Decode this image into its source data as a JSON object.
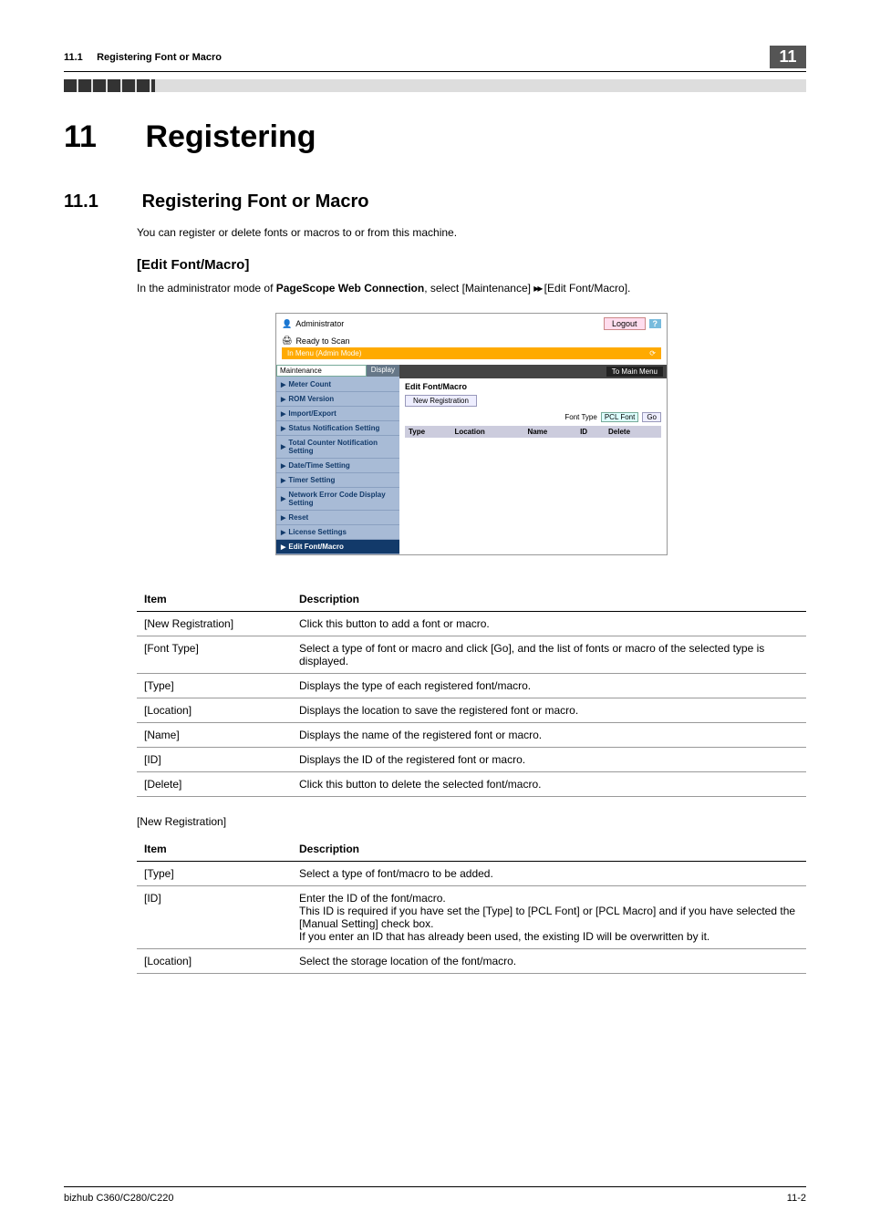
{
  "header": {
    "section_number": "11.1",
    "section_title": "Registering Font or Macro",
    "page_badge": "11"
  },
  "chapter": {
    "number": "11",
    "title": "Registering"
  },
  "section": {
    "number": "11.1",
    "title": "Registering Font or Macro",
    "intro": "You can register or delete fonts or macros to or from this machine."
  },
  "subsection": {
    "title": "[Edit Font/Macro]",
    "instruction_prefix": "In the administrator mode of ",
    "instruction_bold": "PageScope Web Connection",
    "instruction_suffix": ", select [Maintenance] ",
    "instruction_arrows": "▸▸",
    "instruction_tail": " [Edit Font/Macro]."
  },
  "screenshot": {
    "top_user": "Administrator",
    "logout": "Logout",
    "help": "?",
    "status": "Ready to Scan",
    "mode_label": "In Menu (Admin Mode)",
    "sidebar_dropdown": "Maintenance",
    "display_btn": "Display",
    "nav_items": [
      "Meter Count",
      "ROM Version",
      "Import/Export",
      "Status Notification Setting",
      "Total Counter Notification Setting",
      "Date/Time Setting",
      "Timer Setting",
      "Network Error Code Display Setting",
      "Reset",
      "License Settings",
      "Edit Font/Macro"
    ],
    "to_main": "To Main Menu",
    "content_heading": "Edit Font/Macro",
    "new_reg_btn": "New Registration",
    "font_type_label": "Font Type",
    "font_type_value": "PCL Font",
    "go_btn": "Go",
    "table_headers": [
      "Type",
      "Location",
      "Name",
      "ID",
      "Delete"
    ]
  },
  "table1": {
    "col_item": "Item",
    "col_desc": "Description",
    "rows": [
      {
        "item": "[New Registration]",
        "desc": "Click this button to add a font or macro."
      },
      {
        "item": "[Font Type]",
        "desc": "Select a type of font or macro and click [Go], and the list of fonts or macro of the selected type is displayed."
      },
      {
        "item": "[Type]",
        "desc": "Displays the type of each registered font/macro."
      },
      {
        "item": "[Location]",
        "desc": "Displays the location to save the registered font or macro."
      },
      {
        "item": "[Name]",
        "desc": "Displays the name of the registered font or macro."
      },
      {
        "item": "[ID]",
        "desc": "Displays the ID of the registered font or macro."
      },
      {
        "item": "[Delete]",
        "desc": "Click this button to delete the selected font/macro."
      }
    ]
  },
  "table2_heading": "[New Registration]",
  "table2": {
    "col_item": "Item",
    "col_desc": "Description",
    "rows": [
      {
        "item": "[Type]",
        "desc": "Select a type of font/macro to be added."
      },
      {
        "item": "[ID]",
        "desc": "Enter the ID of the font/macro.\nThis ID is required if you have set the [Type] to [PCL Font] or [PCL Macro] and if you have selected the [Manual Setting] check box.\nIf you enter an ID that has already been used, the existing ID will be overwritten by it."
      },
      {
        "item": "[Location]",
        "desc": "Select the storage location of the font/macro."
      }
    ]
  },
  "footer": {
    "left": "bizhub C360/C280/C220",
    "right": "11-2"
  }
}
